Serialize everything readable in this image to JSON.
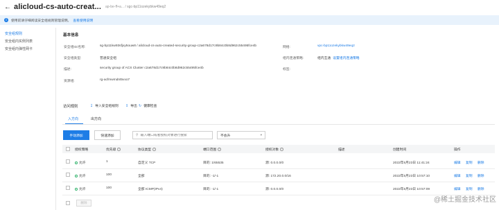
{
  "header": {
    "back_icon": "arrow-left-icon",
    "title": "alicloud-cs-auto-creat...",
    "sub_name": "ap-be-ff+a...",
    "sub_sep": "/",
    "sub_id": "sgc-bp11ozekybkw49eq2"
  },
  "notice": {
    "icon": "info-icon",
    "text": "使用前请仔细阅读安全组规则管理说明。",
    "link": "查看使用说明"
  },
  "sidebar": {
    "items": [
      {
        "label": "安全组规则",
        "active": true
      },
      {
        "label": "安全组内实例列表",
        "active": false
      },
      {
        "label": "安全组内弹性网卡",
        "active": false
      }
    ]
  },
  "basic_info": {
    "section_title": "基本信息",
    "id_name_label": "安全组ID/名称:",
    "id_name_value": "sg-bp11kw93sfjxy5ouw8 / alicloud-cs-auto-created-security-group-c2a678d17c9b84c0b8d962c55495fce4b",
    "network_label": "网络:",
    "network_value": "vpc-bp11ozekybkw49eq2",
    "type_label": "安全组类型:",
    "type_value": "普通安全组",
    "intranet_label": "组内连通策略:",
    "intranet_value": "组内互通",
    "intranet_link": "设置组内连通策略",
    "desc_label": "描述:",
    "desc_value": "security group of ACS Cluster c2a678d17c9b84c0b8d962c55495fce4b",
    "tag_label": "标签:",
    "tag_value": "",
    "rg_label": "资源组:",
    "rg_value": "rg-acfmwmdnt5vxo7"
  },
  "rules": {
    "title": "访问规则",
    "import_label": "导入安全组规则",
    "export_label": "导出",
    "health_label": "健康检查",
    "import_icon": "download-icon",
    "export_icon": "upload-icon",
    "health_icon": "refresh-icon",
    "tabs": [
      {
        "label": "入方向",
        "active": true
      },
      {
        "label": "出方向",
        "active": false
      }
    ],
    "add_manual": "手动添加",
    "add_quick": "快速添加",
    "search_icon": "search-icon",
    "search_placeholder": "输入端口或者授权对象进行搜索",
    "select_value": "不会升",
    "select_icon": "chevron-down-icon"
  },
  "table": {
    "columns": [
      "授权策略",
      "优先级",
      "协议类型",
      "端口范围",
      "授权对象",
      "描述",
      "创建时间",
      "操作"
    ],
    "rows": [
      {
        "policy": "允许",
        "priority": "1",
        "protocol": "自定义 TCP",
        "port": "目的: 1/65535",
        "auth": "源: 0.0.0.0/0",
        "desc": "",
        "created": "2022年6月23日 11:41:24",
        "ops": [
          "编辑",
          "复制",
          "删除"
        ]
      },
      {
        "policy": "允许",
        "priority": "100",
        "protocol": "全部",
        "port": "目的: -1/-1",
        "auth": "源: 172.20.0.0/16",
        "desc": "",
        "created": "2022年6月23日 10:57:10",
        "ops": [
          "编辑",
          "复制",
          "删除"
        ]
      },
      {
        "policy": "允许",
        "priority": "100",
        "protocol": "全部 ICMP(IPv4)",
        "port": "目的: -1/-1",
        "auth": "源: 0.0.0.0/0",
        "desc": "",
        "created": "2022年6月23日 10:57:09",
        "ops": [
          "编辑",
          "复制",
          "删除"
        ]
      }
    ],
    "delete_button": "删除"
  },
  "watermark": "@稀土掘金技术社区",
  "colors": {
    "accent": "#1e7de6",
    "allow": "#2fb26a",
    "notice_bg": "#e8f2fc"
  }
}
